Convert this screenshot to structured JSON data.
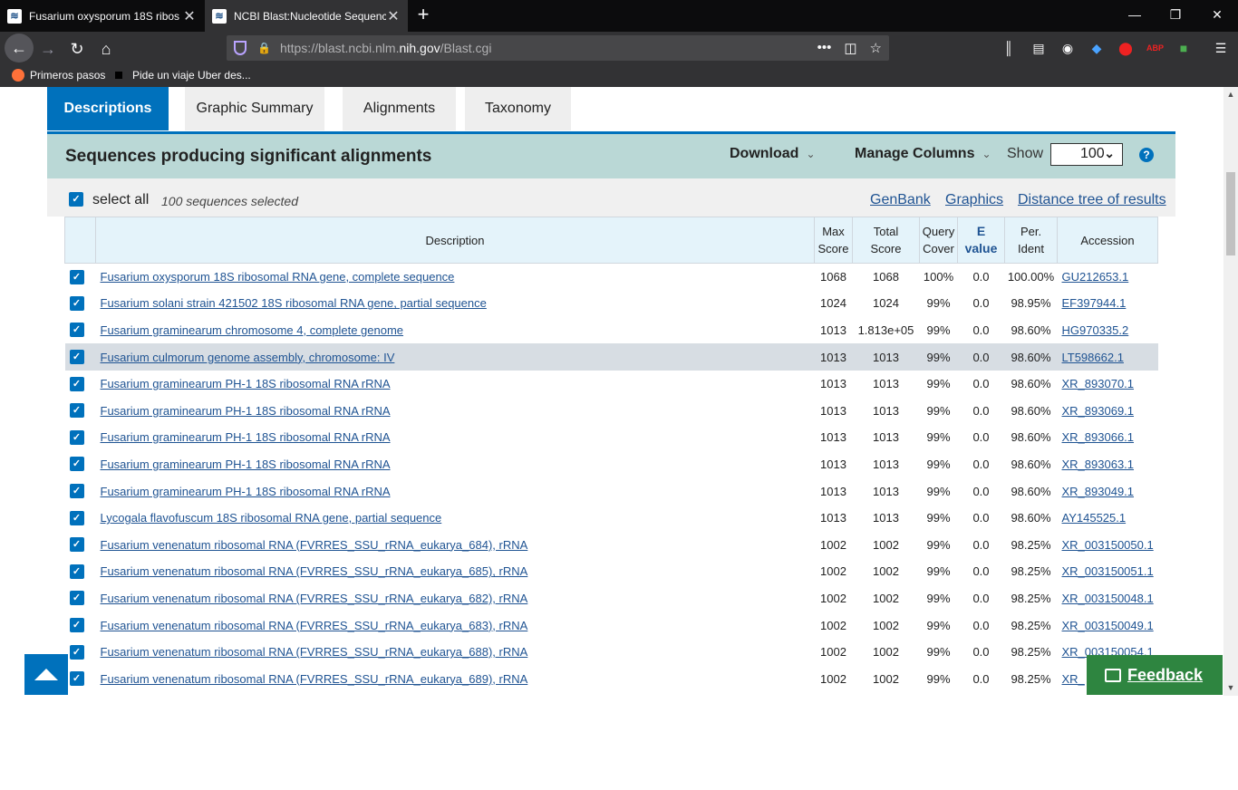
{
  "browser": {
    "tabs": [
      {
        "title": "Fusarium oxysporum 18S ribos",
        "close": "✕"
      },
      {
        "title": "NCBI Blast:Nucleotide Sequenc",
        "close": "✕"
      }
    ],
    "new_tab": "+",
    "window_controls": {
      "minimize": "—",
      "restore": "❐",
      "close": "✕"
    },
    "url_prefix": "https://blast.ncbi.nlm.",
    "url_domain": "nih.gov",
    "url_suffix": "/Blast.cgi",
    "bookmarks": [
      "Primeros pasos",
      "Pide un viaje Uber des..."
    ]
  },
  "page_tabs": [
    "Descriptions",
    "Graphic Summary",
    "Alignments",
    "Taxonomy"
  ],
  "results_bar": {
    "title": "Sequences producing significant alignments",
    "download": "Download",
    "manage_columns": "Manage Columns",
    "show_label": "Show",
    "show_value": "100",
    "help": "?"
  },
  "select_row": {
    "select_all": "select all",
    "count": "100 sequences selected",
    "links": [
      "GenBank",
      "Graphics",
      "Distance tree of results"
    ]
  },
  "table": {
    "headers": {
      "description": "Description",
      "max_score": [
        "Max",
        "Score"
      ],
      "total_score": [
        "Total",
        "Score"
      ],
      "query_cover": [
        "Query",
        "Cover"
      ],
      "e_value": [
        "E",
        "value"
      ],
      "per_ident": [
        "Per.",
        "Ident"
      ],
      "accession": "Accession"
    },
    "rows": [
      {
        "desc": "Fusarium oxysporum 18S ribosomal RNA gene, complete sequence",
        "max": "1068",
        "total": "1068",
        "cover": "100%",
        "e": "0.0",
        "ident": "100.00%",
        "acc": "GU212653.1"
      },
      {
        "desc": "Fusarium solani strain 421502 18S ribosomal RNA gene, partial sequence",
        "max": "1024",
        "total": "1024",
        "cover": "99%",
        "e": "0.0",
        "ident": "98.95%",
        "acc": "EF397944.1"
      },
      {
        "desc": "Fusarium graminearum chromosome 4, complete genome",
        "max": "1013",
        "total": "1.813e+05",
        "cover": "99%",
        "e": "0.0",
        "ident": "98.60%",
        "acc": "HG970335.2"
      },
      {
        "desc": "Fusarium culmorum genome assembly, chromosome: IV",
        "max": "1013",
        "total": "1013",
        "cover": "99%",
        "e": "0.0",
        "ident": "98.60%",
        "acc": "LT598662.1"
      },
      {
        "desc": "Fusarium graminearum PH-1 18S ribosomal RNA rRNA",
        "max": "1013",
        "total": "1013",
        "cover": "99%",
        "e": "0.0",
        "ident": "98.60%",
        "acc": "XR_893070.1"
      },
      {
        "desc": "Fusarium graminearum PH-1 18S ribosomal RNA rRNA",
        "max": "1013",
        "total": "1013",
        "cover": "99%",
        "e": "0.0",
        "ident": "98.60%",
        "acc": "XR_893069.1"
      },
      {
        "desc": "Fusarium graminearum PH-1 18S ribosomal RNA rRNA",
        "max": "1013",
        "total": "1013",
        "cover": "99%",
        "e": "0.0",
        "ident": "98.60%",
        "acc": "XR_893066.1"
      },
      {
        "desc": "Fusarium graminearum PH-1 18S ribosomal RNA rRNA",
        "max": "1013",
        "total": "1013",
        "cover": "99%",
        "e": "0.0",
        "ident": "98.60%",
        "acc": "XR_893063.1"
      },
      {
        "desc": "Fusarium graminearum PH-1 18S ribosomal RNA rRNA",
        "max": "1013",
        "total": "1013",
        "cover": "99%",
        "e": "0.0",
        "ident": "98.60%",
        "acc": "XR_893049.1"
      },
      {
        "desc": "Lycogala flavofuscum 18S ribosomal RNA gene, partial sequence",
        "max": "1013",
        "total": "1013",
        "cover": "99%",
        "e": "0.0",
        "ident": "98.60%",
        "acc": "AY145525.1"
      },
      {
        "desc": "Fusarium venenatum ribosomal RNA (FVRRES_SSU_rRNA_eukarya_684), rRNA",
        "max": "1002",
        "total": "1002",
        "cover": "99%",
        "e": "0.0",
        "ident": "98.25%",
        "acc": "XR_003150050.1"
      },
      {
        "desc": "Fusarium venenatum ribosomal RNA (FVRRES_SSU_rRNA_eukarya_685), rRNA",
        "max": "1002",
        "total": "1002",
        "cover": "99%",
        "e": "0.0",
        "ident": "98.25%",
        "acc": "XR_003150051.1"
      },
      {
        "desc": "Fusarium venenatum ribosomal RNA (FVRRES_SSU_rRNA_eukarya_682), rRNA",
        "max": "1002",
        "total": "1002",
        "cover": "99%",
        "e": "0.0",
        "ident": "98.25%",
        "acc": "XR_003150048.1"
      },
      {
        "desc": "Fusarium venenatum ribosomal RNA (FVRRES_SSU_rRNA_eukarya_683), rRNA",
        "max": "1002",
        "total": "1002",
        "cover": "99%",
        "e": "0.0",
        "ident": "98.25%",
        "acc": "XR_003150049.1"
      },
      {
        "desc": "Fusarium venenatum ribosomal RNA (FVRRES_SSU_rRNA_eukarya_688), rRNA",
        "max": "1002",
        "total": "1002",
        "cover": "99%",
        "e": "0.0",
        "ident": "98.25%",
        "acc": "XR_003150054.1"
      },
      {
        "desc": "Fusarium venenatum ribosomal RNA (FVRRES_SSU_rRNA_eukarya_689), rRNA",
        "max": "1002",
        "total": "1002",
        "cover": "99%",
        "e": "0.0",
        "ident": "98.25%",
        "acc": "XR_"
      }
    ],
    "highlighted_row": 3
  },
  "feedback": "Feedback",
  "icons": {
    "back": "back-arrow-icon",
    "forward": "forward-arrow-icon",
    "reload": "reload-icon",
    "home": "home-icon",
    "library": "library-icon",
    "sidebar": "sidebar-icon",
    "account": "account-icon",
    "menu": "hamburger-menu-icon"
  },
  "colors": {
    "accent": "#0071bc",
    "results_bar": "#bad8d6",
    "link": "#205493",
    "feedback": "#2e8540"
  }
}
